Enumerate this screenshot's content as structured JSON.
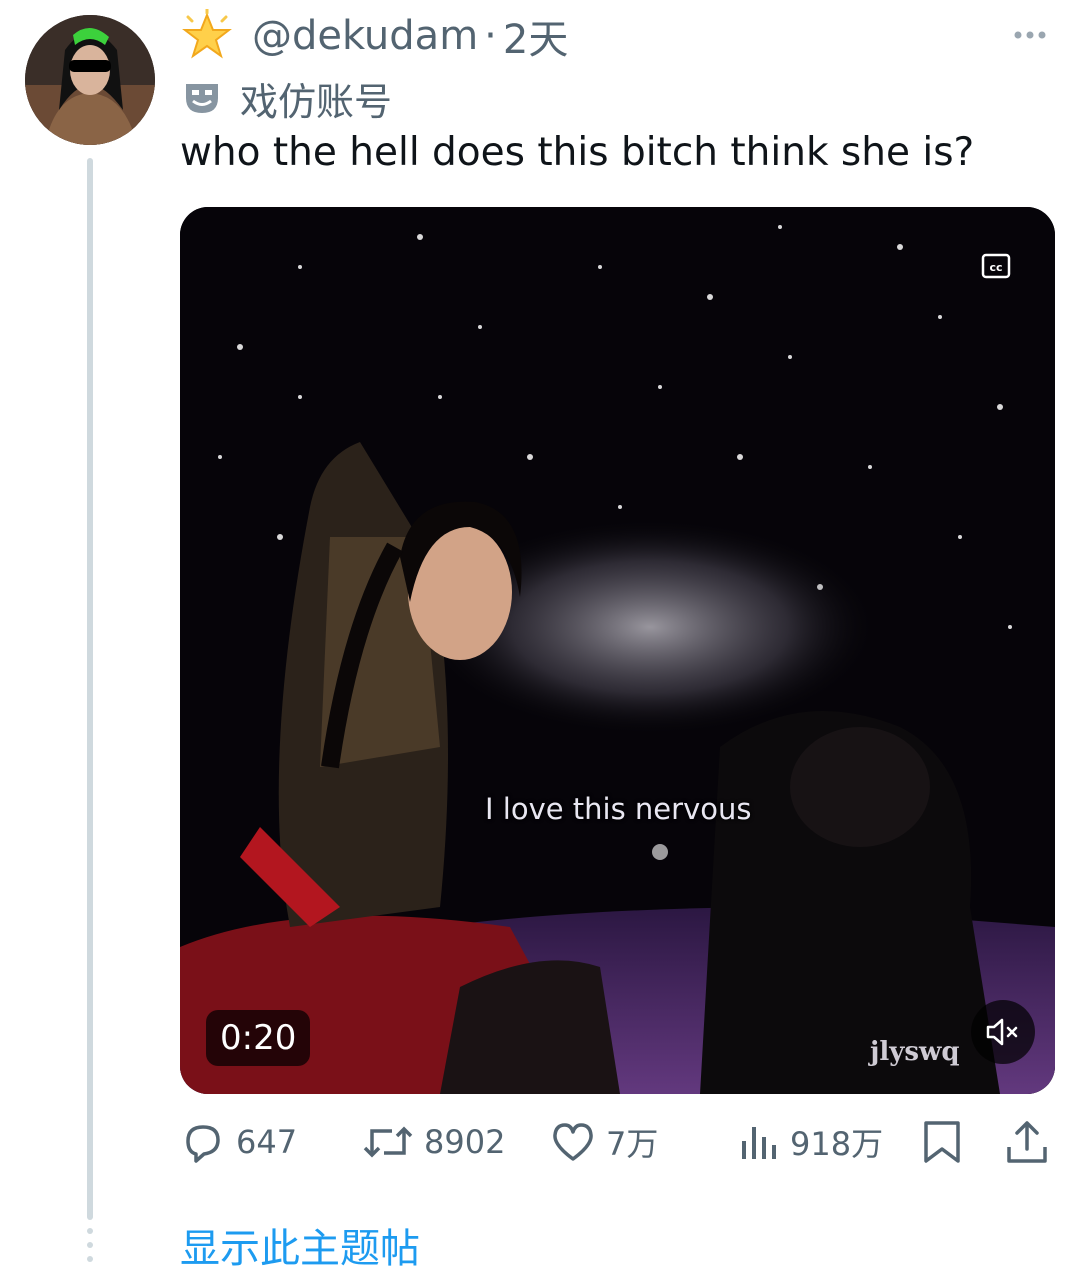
{
  "tweet": {
    "handle": "@dekudam",
    "separator": "·",
    "time": "2天",
    "parody_label": "戏仿账号",
    "text": "who the hell does this bitch think she is?"
  },
  "media": {
    "subtitle": "I love this nervous",
    "watermark": "jlyswq",
    "duration": "0:20"
  },
  "actions": {
    "replies": "647",
    "retweets": "8902",
    "likes": "7万",
    "views": "918万"
  },
  "show_thread": "显示此主题帖",
  "colors": {
    "link": "#1d9bf0",
    "secondary_text": "#536471",
    "thread_line": "#cfd9de"
  }
}
